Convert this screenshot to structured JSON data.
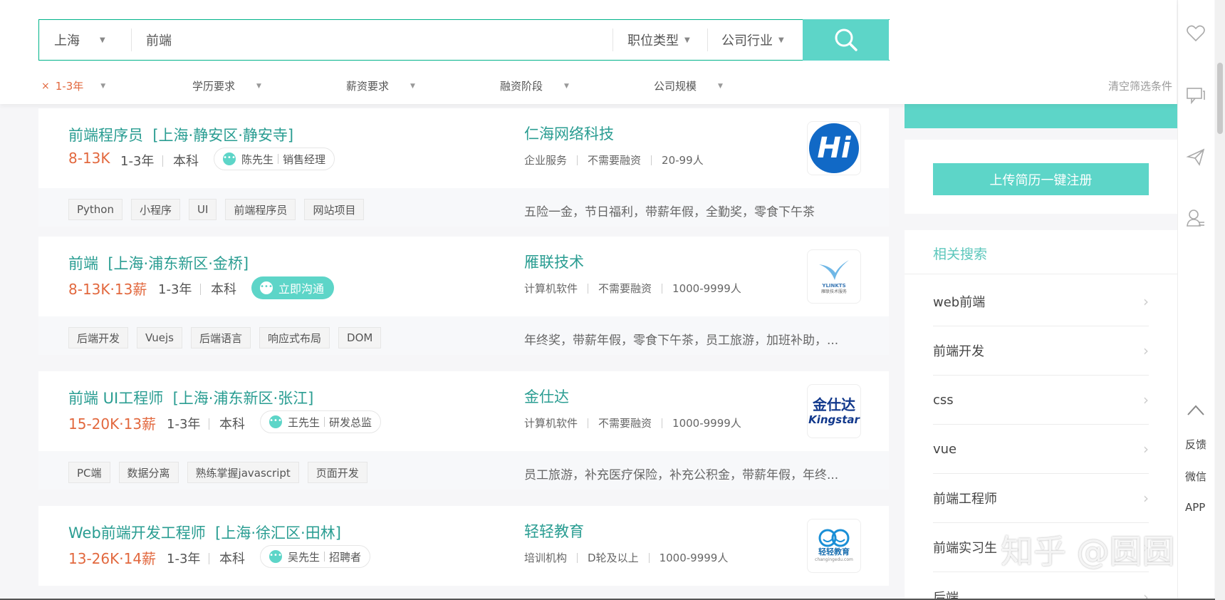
{
  "search": {
    "city": "上海",
    "query": "前端",
    "job_type": "职位类型",
    "industry": "公司行业"
  },
  "filters": {
    "experience_selected": "1-3年",
    "experience_remove": "×",
    "education": "学历要求",
    "salary": "薪资要求",
    "funding": "融资阶段",
    "size": "公司规模",
    "clear": "清空筛选条件"
  },
  "jobs": [
    {
      "title": "前端程序员",
      "location": "[上海·静安区·静安寺]",
      "salary": "8-13K",
      "experience": "1-3年",
      "education": "本科",
      "hr_name": "陈先生",
      "hr_role": "销售经理",
      "company": "仁海网络科技",
      "industry": "企业服务",
      "funding": "不需要融资",
      "size": "20-99人",
      "tags": [
        "Python",
        "小程序",
        "UI",
        "前端程序员",
        "网站项目"
      ],
      "benefits": "五险一金，节日福利，带薪年假，全勤奖，零食下午茶",
      "logo_text": "Hi"
    },
    {
      "title": "前端",
      "location": "[上海·浦东新区·金桥]",
      "salary": "8-13K·13薪",
      "experience": "1-3年",
      "education": "本科",
      "chat_label": "立即沟通",
      "company": "雁联技术",
      "industry": "计算机软件",
      "funding": "不需要融资",
      "size": "1000-9999人",
      "tags": [
        "后端开发",
        "Vuejs",
        "后端语言",
        "响应式布局",
        "DOM"
      ],
      "benefits": "年终奖，带薪年假，零食下午茶，员工旅游，加班补助，...",
      "logo_text": "YLINKTS",
      "logo_sub": "雁联技术服务"
    },
    {
      "title": "前端 UI工程师",
      "location": "[上海·浦东新区·张江]",
      "salary": "15-20K·13薪",
      "experience": "1-3年",
      "education": "本科",
      "hr_name": "王先生",
      "hr_role": "研发总监",
      "company": "金仕达",
      "industry": "计算机软件",
      "funding": "不需要融资",
      "size": "1000-9999人",
      "tags": [
        "PC端",
        "数据分离",
        "熟练掌握javascript",
        "页面开发"
      ],
      "benefits": "员工旅游，补充医疗保险，补充公积金，带薪年假，年终...",
      "logo_text": "金仕达",
      "logo_sub": "Kingstar"
    },
    {
      "title": "Web前端开发工程师",
      "location": "[上海·徐汇区·田林]",
      "salary": "13-26K·14薪",
      "experience": "1-3年",
      "education": "本科",
      "hr_name": "吴先生",
      "hr_role": "招聘者",
      "company": "轻轻教育",
      "industry": "培训机构",
      "funding": "D轮及以上",
      "size": "1000-9999人",
      "logo_text": "轻轻教育",
      "logo_sub": "changingedu.com"
    }
  ],
  "sidebar": {
    "upload_label": "上传简历一键注册",
    "related_title": "相关搜索",
    "related": [
      "web前端",
      "前端开发",
      "css",
      "vue",
      "前端工程师",
      "前端实习生",
      "后端"
    ]
  },
  "rail": {
    "icons": [
      "heart-icon",
      "chat-icon",
      "send-icon",
      "user-icon",
      "up-arrow-icon"
    ],
    "feedback": "反馈",
    "wechat": "微信",
    "app": "APP"
  },
  "watermark": "知乎 @圆圆",
  "colors": {
    "accent": "#5dd5c8",
    "title": "#2a9d92",
    "salary": "#e2683e"
  }
}
